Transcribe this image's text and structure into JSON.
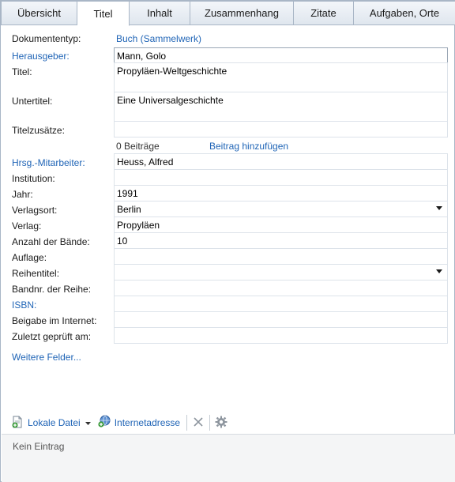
{
  "tabs": [
    {
      "label": "Übersicht"
    },
    {
      "label": "Titel"
    },
    {
      "label": "Inhalt"
    },
    {
      "label": "Zusammenhang"
    },
    {
      "label": "Zitate"
    },
    {
      "label": "Aufgaben, Orte"
    }
  ],
  "active_tab": "Titel",
  "form": {
    "doctype_label": "Dokumententyp:",
    "doctype_value": "Buch (Sammelwerk)",
    "editor_label": "Herausgeber:",
    "editor_value": "Mann, Golo",
    "title_label": "Titel:",
    "title_value": "Propyläen-Weltgeschichte",
    "subtitle_label": "Untertitel:",
    "subtitle_value": "Eine Universalgeschichte",
    "title_suffix_label": "Titelzusätze:",
    "title_suffix_value": "",
    "contributions_count": "0 Beiträge",
    "add_contribution": "Beitrag hinzufügen",
    "coeditor_label": "Hrsg.-Mitarbeiter:",
    "coeditor_value": "Heuss, Alfred",
    "institution_label": "Institution:",
    "institution_value": "",
    "year_label": "Jahr:",
    "year_value": "1991",
    "place_label": "Verlagsort:",
    "place_value": "Berlin",
    "publisher_label": "Verlag:",
    "publisher_value": "Propyläen",
    "volumes_label": "Anzahl der Bände:",
    "volumes_value": "10",
    "edition_label": "Auflage:",
    "edition_value": "",
    "series_label": "Reihentitel:",
    "series_value": "",
    "series_no_label": "Bandnr. der Reihe:",
    "series_no_value": "",
    "isbn_label": "ISBN:",
    "isbn_value": "",
    "online_label": "Beigabe im Internet:",
    "online_value": "",
    "checked_label": "Zuletzt geprüft am:",
    "checked_value": "",
    "more_fields": "Weitere Felder..."
  },
  "toolbar": {
    "local_file": "Lokale Datei",
    "internet_address": "Internetadresse"
  },
  "attachments": {
    "empty_text": "Kein Eintrag"
  },
  "colors": {
    "link": "#1f64b6",
    "border": "#a9b6c6"
  }
}
